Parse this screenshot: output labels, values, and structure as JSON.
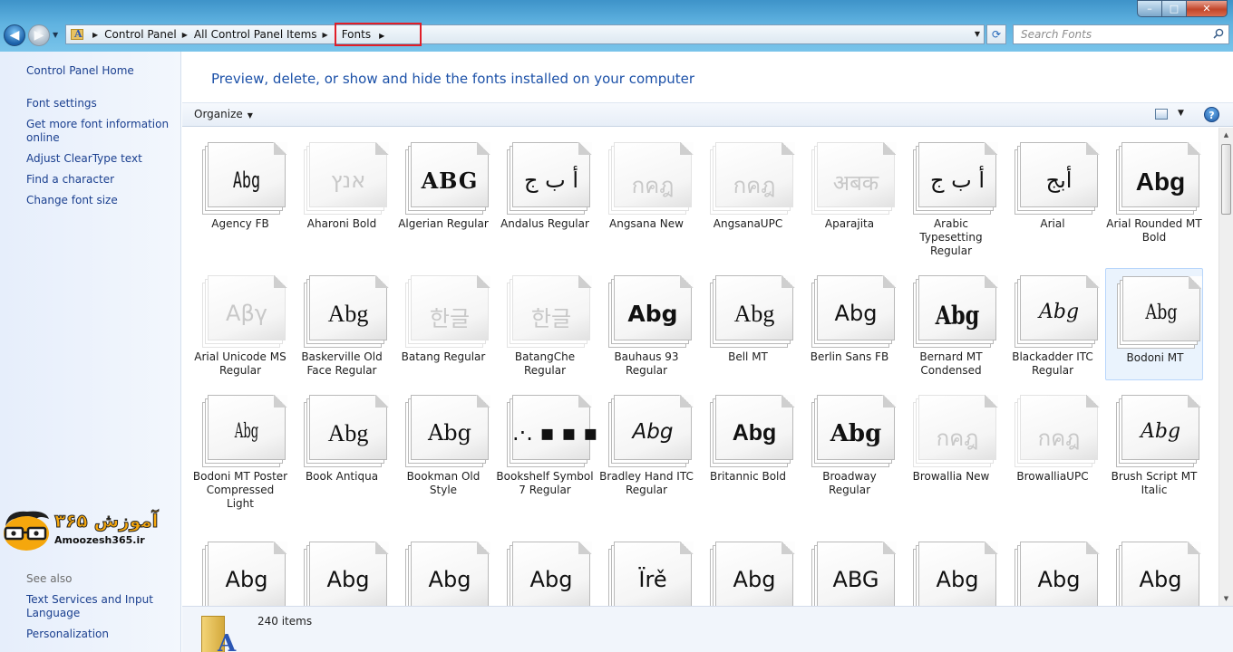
{
  "window": {
    "controls": {
      "minimize": "–",
      "maximize": "□",
      "close": "✕"
    }
  },
  "address": {
    "crumbs": [
      "Control Panel",
      "All Control Panel Items",
      "Fonts"
    ],
    "search_placeholder": "Search Fonts"
  },
  "sidebar": {
    "home": "Control Panel Home",
    "links": [
      "Font settings",
      "Get more font information online",
      "Adjust ClearType text",
      "Find a character",
      "Change font size"
    ],
    "see_also_header": "See also",
    "see_also": [
      "Text Services and Input Language",
      "Personalization"
    ],
    "logo": {
      "text_fa": "آموزش ۳۶۵",
      "text_en": "Amoozesh365.ir"
    }
  },
  "main": {
    "title": "Preview, delete, or show and hide the fonts installed on your computer",
    "toolbar": {
      "organize": "Organize",
      "help": "?"
    }
  },
  "fonts": [
    {
      "name": "Agency FB",
      "glyph": "Abg",
      "faded": false
    },
    {
      "name": "Aharoni Bold",
      "glyph": "אנץ",
      "faded": true
    },
    {
      "name": "Algerian Regular",
      "glyph": "ABG",
      "faded": false
    },
    {
      "name": "Andalus Regular",
      "glyph": "أ ب ج",
      "faded": false
    },
    {
      "name": "Angsana New",
      "glyph": "กคฎ",
      "faded": true
    },
    {
      "name": "AngsanaUPC",
      "glyph": "กคฎ",
      "faded": true
    },
    {
      "name": "Aparajita",
      "glyph": "अबक",
      "faded": true
    },
    {
      "name": "Arabic Typesetting Regular",
      "glyph": "أ ب ج",
      "faded": false
    },
    {
      "name": "Arial",
      "glyph": "أبج",
      "faded": false
    },
    {
      "name": "Arial Rounded MT Bold",
      "glyph": "Abg",
      "faded": false
    },
    {
      "name": "Arial Unicode MS Regular",
      "glyph": "Αβγ",
      "faded": true
    },
    {
      "name": "Baskerville Old Face Regular",
      "glyph": "Abg",
      "faded": false
    },
    {
      "name": "Batang Regular",
      "glyph": "한글",
      "faded": true
    },
    {
      "name": "BatangChe Regular",
      "glyph": "한글",
      "faded": true
    },
    {
      "name": "Bauhaus 93 Regular",
      "glyph": "Abg",
      "faded": false
    },
    {
      "name": "Bell MT",
      "glyph": "Abg",
      "faded": false
    },
    {
      "name": "Berlin Sans FB",
      "glyph": "Abg",
      "faded": false
    },
    {
      "name": "Bernard MT Condensed",
      "glyph": "Abg",
      "faded": false
    },
    {
      "name": "Blackadder ITC Regular",
      "glyph": "Abg",
      "faded": false
    },
    {
      "name": "Bodoni MT",
      "glyph": "Abg",
      "faded": false,
      "selected": true
    },
    {
      "name": "Bodoni MT Poster Compressed Light",
      "glyph": "Abg",
      "faded": false
    },
    {
      "name": "Book Antiqua",
      "glyph": "Abg",
      "faded": false
    },
    {
      "name": "Bookman Old Style",
      "glyph": "Abg",
      "faded": false
    },
    {
      "name": "Bookshelf Symbol 7 Regular",
      "glyph": ".·.  ▪  ▪  ▪",
      "faded": false
    },
    {
      "name": "Bradley Hand ITC Regular",
      "glyph": "Abg",
      "faded": false
    },
    {
      "name": "Britannic Bold",
      "glyph": "Abg",
      "faded": false
    },
    {
      "name": "Broadway Regular",
      "glyph": "Abg",
      "faded": false
    },
    {
      "name": "Browallia New",
      "glyph": "กคฎ",
      "faded": true
    },
    {
      "name": "BrowalliaUPC",
      "glyph": "กคฎ",
      "faded": true
    },
    {
      "name": "Brush Script MT Italic",
      "glyph": "Abg",
      "faded": false
    },
    {
      "name": "",
      "glyph": "Abg",
      "faded": false
    },
    {
      "name": "",
      "glyph": "Abg",
      "faded": false
    },
    {
      "name": "",
      "glyph": "Abg",
      "faded": false
    },
    {
      "name": "",
      "glyph": "Abg",
      "faded": false
    },
    {
      "name": "",
      "glyph": "Ïrě",
      "faded": false
    },
    {
      "name": "",
      "glyph": "Abg",
      "faded": false
    },
    {
      "name": "",
      "glyph": "ABG",
      "faded": false
    },
    {
      "name": "",
      "glyph": "Abg",
      "faded": false
    },
    {
      "name": "",
      "glyph": "Abg",
      "faded": false
    },
    {
      "name": "",
      "glyph": "Abg",
      "faded": false
    }
  ],
  "status": {
    "count": "240 items"
  },
  "colors": {
    "link": "#1a3f8f",
    "title": "#1c51a8",
    "highlight_box": "#e01e28"
  }
}
